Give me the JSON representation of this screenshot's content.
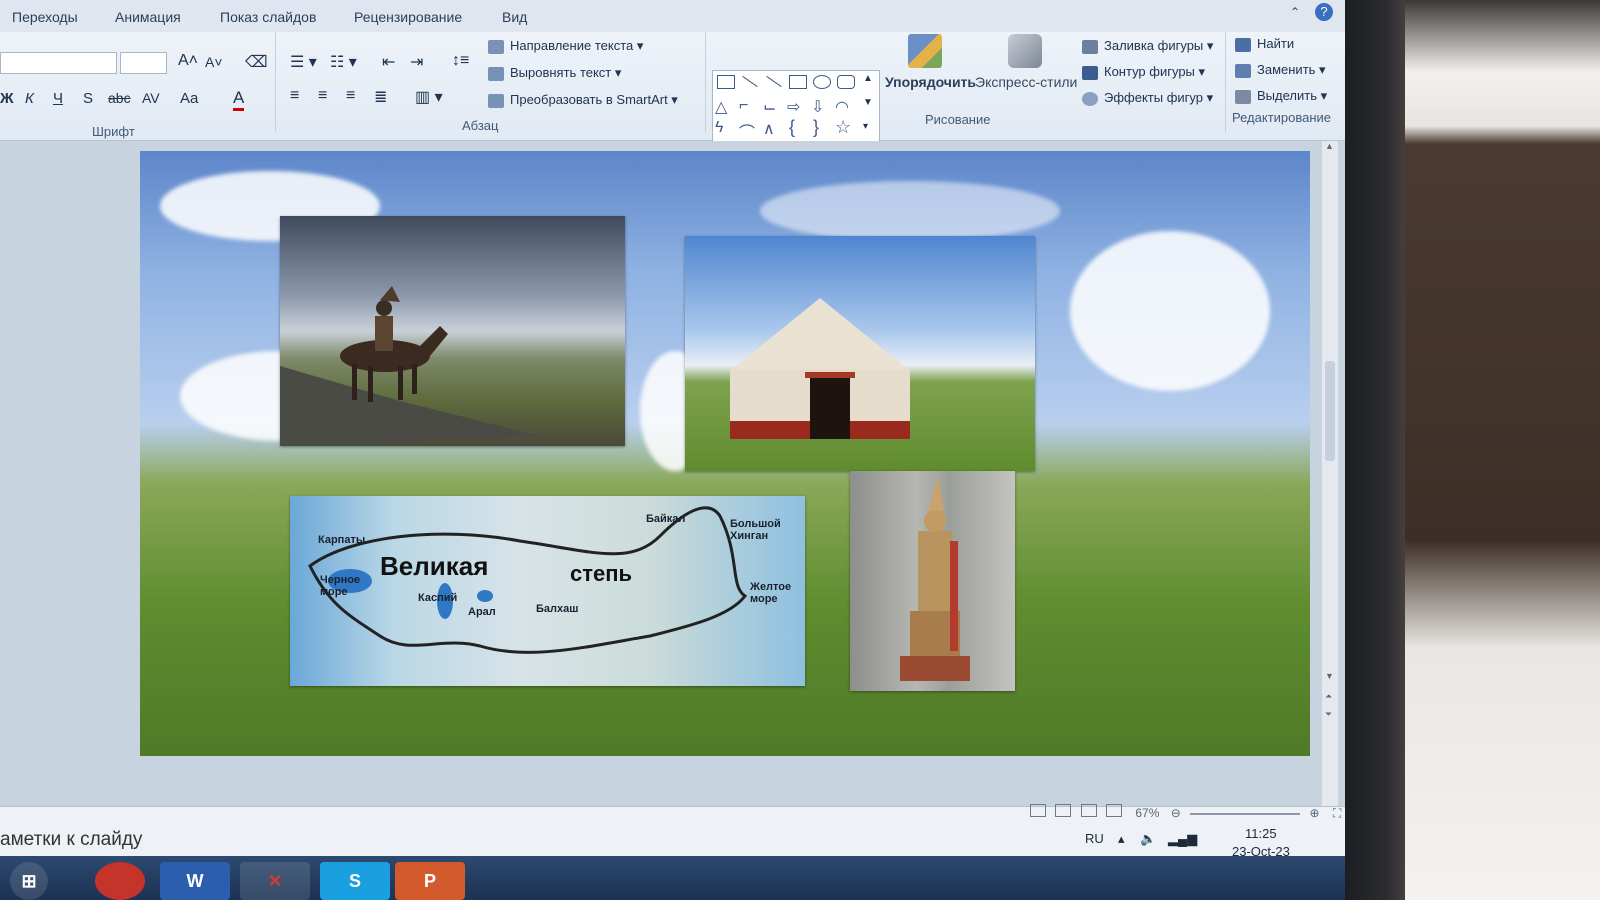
{
  "menu_tabs": [
    "Переходы",
    "Анимация",
    "Показ слайдов",
    "Рецензирование",
    "Вид"
  ],
  "ribbon": {
    "font_group": "Шрифт",
    "paragraph_group": "Абзац",
    "drawing_group": "Рисование",
    "editing_group": "Редактирование",
    "text_direction": "Направление текста",
    "align_text": "Выровнять текст",
    "convert_smartart": "Преобразовать в SmartArt",
    "arrange": "Упорядочить",
    "quick_styles": "Экспресс-стили",
    "shape_fill": "Заливка фигуры",
    "shape_outline": "Контур фигуры",
    "shape_effects": "Эффекты фигур",
    "find": "Найти",
    "replace": "Заменить",
    "select": "Выделить",
    "font_buttons": [
      "Ж",
      "К",
      "Ч",
      "S",
      "abc",
      "AV",
      "Aa",
      "A"
    ]
  },
  "slide": {
    "map": {
      "title_left": "Великая",
      "title_right": "степь",
      "labels": {
        "karpaty": "Карпаты",
        "black_sea": "Черное море",
        "caspian": "Каспий",
        "aral": "Арал",
        "balkhash": "Балхаш",
        "baikal": "Байкал",
        "khingan": "Большой Хинган",
        "yellow_sea": "Желтое море"
      }
    }
  },
  "notes_placeholder": "аметки к слайду",
  "status": {
    "zoom": "67%"
  },
  "tray": {
    "lang": "RU",
    "time": "11:25",
    "date": "23-Oct-23"
  },
  "taskbar_apps": [
    "W",
    "S",
    "P"
  ]
}
